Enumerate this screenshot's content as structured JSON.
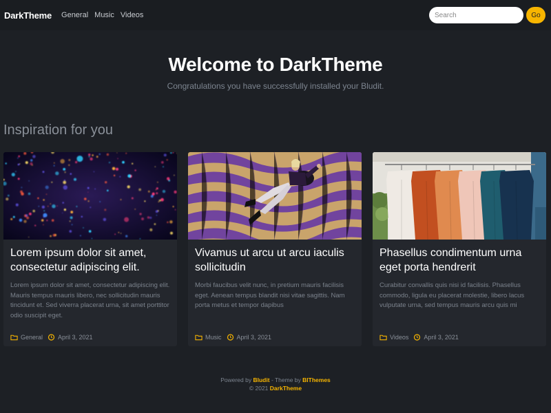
{
  "nav": {
    "brand": "DarkTheme",
    "links": [
      "General",
      "Music",
      "Videos"
    ],
    "search_placeholder": "Search",
    "go_label": "Go"
  },
  "hero": {
    "title": "Welcome to DarkTheme",
    "subtitle": "Congratulations you have successfully installed your Bludit."
  },
  "section_title": "Inspiration for you",
  "cards": [
    {
      "title": "Lorem ipsum dolor sit amet, consectetur adipiscing elit.",
      "text": "Lorem ipsum dolor sit amet, consectetur adipiscing elit. Mauris tempus mauris libero, nec sollicitudin mauris tincidunt et. Sed viverra placerat urna, sit amet porttitor odio suscipit eget.",
      "category": "General",
      "date": "April 3, 2021",
      "image": "bokeh-lights-image"
    },
    {
      "title": "Vivamus ut arcu ut arcu iaculis sollicitudin",
      "text": "Morbi faucibus velit nunc, in pretium mauris facilisis eget. Aenean tempus blandit nisi vitae sagittis. Nam porta metus et tempor dapibus",
      "category": "Music",
      "date": "April 3, 2021",
      "image": "woman-on-purple-floor-image"
    },
    {
      "title": "Phasellus condimentum urna eget porta hendrerit",
      "text": "Curabitur convallis quis nisi id facilisis. Phasellus commodo, ligula eu placerat molestie, libero lacus vulputate urna, sed tempus mauris arcu quis mi",
      "category": "Videos",
      "date": "April 3, 2021",
      "image": "clothes-rack-image"
    }
  ],
  "footer": {
    "powered_by": "Powered by",
    "bludit": "Bludit",
    "theme_by": "- Theme by",
    "bithemes": "BIThemes",
    "copyright": "© 2021",
    "site": "DarkTheme"
  },
  "colors": {
    "accent": "#f7b500",
    "background": "#1d2025",
    "card": "#24272d"
  }
}
